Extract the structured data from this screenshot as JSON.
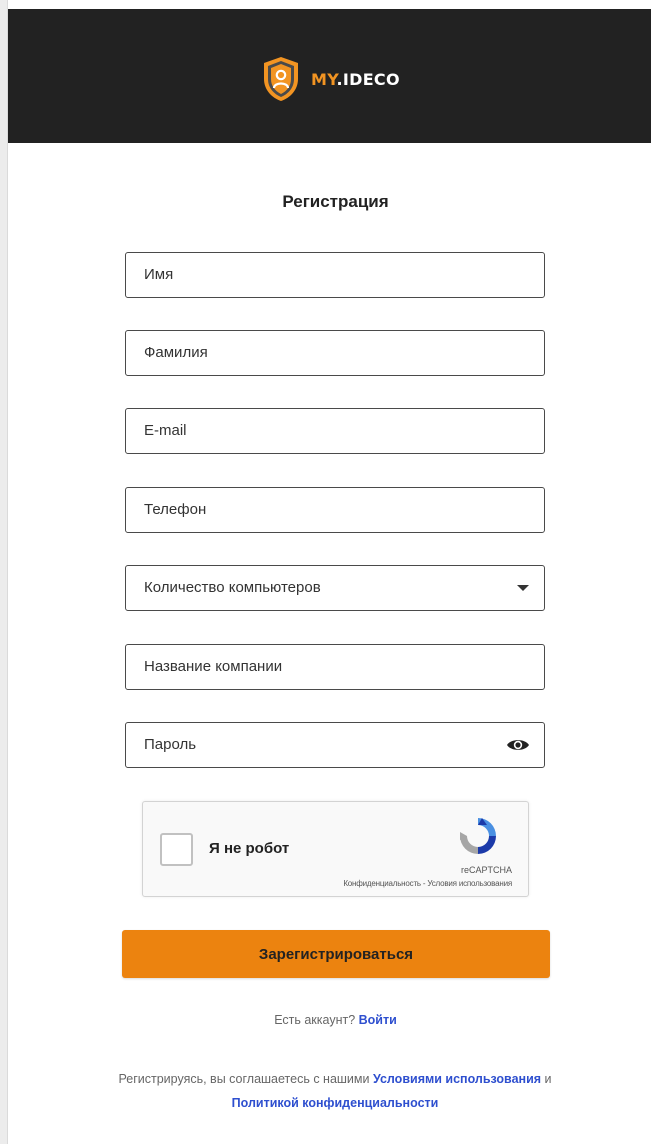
{
  "header": {
    "logo_my": "MY",
    "logo_dot": ".",
    "logo_ideco": "IDECO"
  },
  "form": {
    "title": "Регистрация",
    "fields": {
      "first_name": "Имя",
      "last_name": "Фамилия",
      "email": "E-mail",
      "phone": "Телефон",
      "computers": "Количество компьютеров",
      "company": "Название компании",
      "password": "Пароль"
    },
    "captcha": {
      "label": "Я не робот",
      "brand": "reCAPTCHA",
      "privacy": "Конфиденциальность",
      "separator": " - ",
      "terms": "Условия использования"
    },
    "submit_label": "Зарегистрироваться",
    "has_account_text": "Есть аккаунт?",
    "login_link": "Войти",
    "terms_prefix": "Регистрируясь, вы соглашаетесь с нашими",
    "terms_link1": "Условиями использования",
    "terms_and": "и",
    "terms_link2": "Политикой конфиденциальности"
  },
  "colors": {
    "header_bg": "#222222",
    "accent_orange": "#ec830f",
    "link_blue": "#2e4fcf"
  },
  "icons": {
    "logo": "shield-user-icon",
    "dropdown": "caret-down-icon",
    "password_toggle": "eye-icon",
    "captcha": "recaptcha-icon"
  }
}
